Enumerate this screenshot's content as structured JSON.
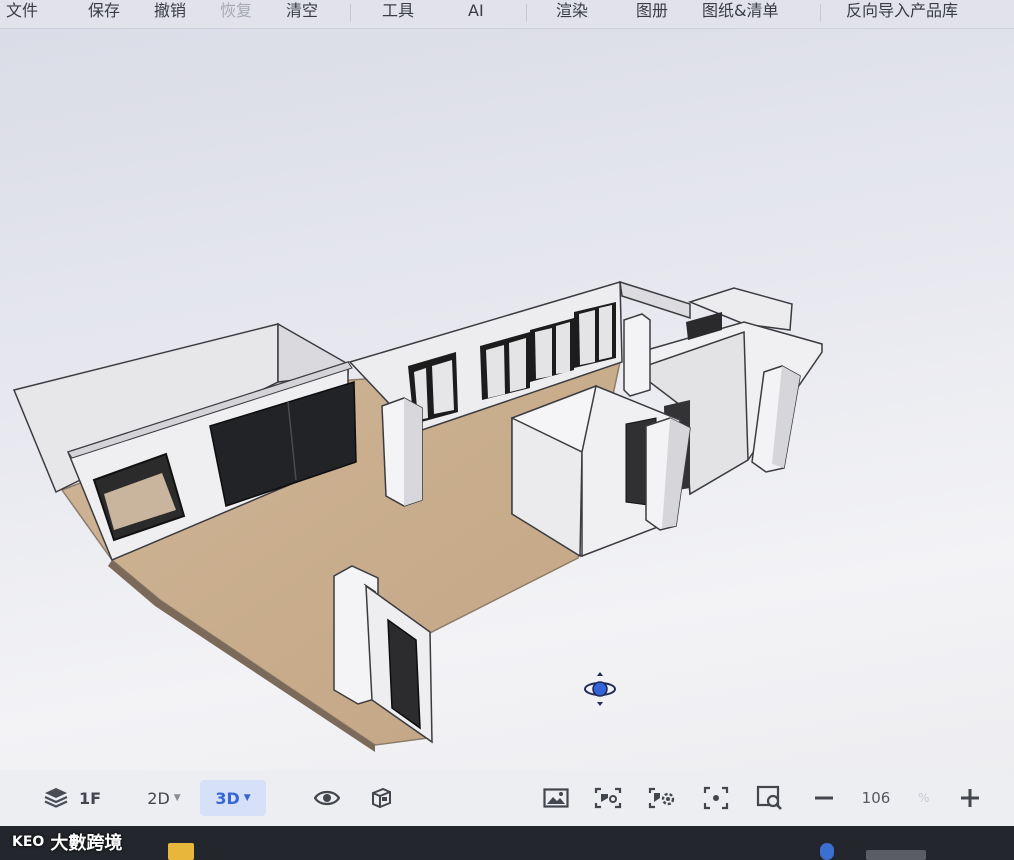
{
  "menu": {
    "items": [
      {
        "label": "文件",
        "disabled": false
      },
      {
        "label": "保存",
        "disabled": false
      },
      {
        "label": "撤销",
        "disabled": false
      },
      {
        "label": "恢复",
        "disabled": true
      },
      {
        "label": "清空",
        "disabled": false
      },
      {
        "label": "工具",
        "disabled": false
      },
      {
        "label": "AI",
        "disabled": false
      },
      {
        "label": "渲染",
        "disabled": false
      },
      {
        "label": "图册",
        "disabled": false
      },
      {
        "label": "图纸&清单",
        "disabled": false
      },
      {
        "label": "反向导入产品库",
        "disabled": false
      }
    ]
  },
  "toolbar": {
    "layers_icon": "layers-icon",
    "floor_label": "1F",
    "view_2d_label": "2D",
    "view_3d_label": "3D",
    "active_view": "3D",
    "visibility_icon": "eye-icon",
    "cube_icon": "cube-icon",
    "right_tools": [
      "image-icon",
      "screenshot-icon",
      "camera-settings-icon",
      "focus-icon",
      "search-view-icon"
    ],
    "zoom_out_icon": "minus-icon",
    "zoom_value": "106",
    "zoom_unit": "%",
    "zoom_in_icon": "plus-icon"
  },
  "viewport": {
    "hint_text": "",
    "gizmo_icon": "orbit-gizmo-icon",
    "floor_color": "#c9ad8d",
    "wall_color": "#f1f1f3"
  },
  "watermark": {
    "logo_text": "KEO",
    "text": "大數跨境"
  },
  "colors": {
    "accent": "#3767d6",
    "active_bg": "#d6e0f8"
  }
}
